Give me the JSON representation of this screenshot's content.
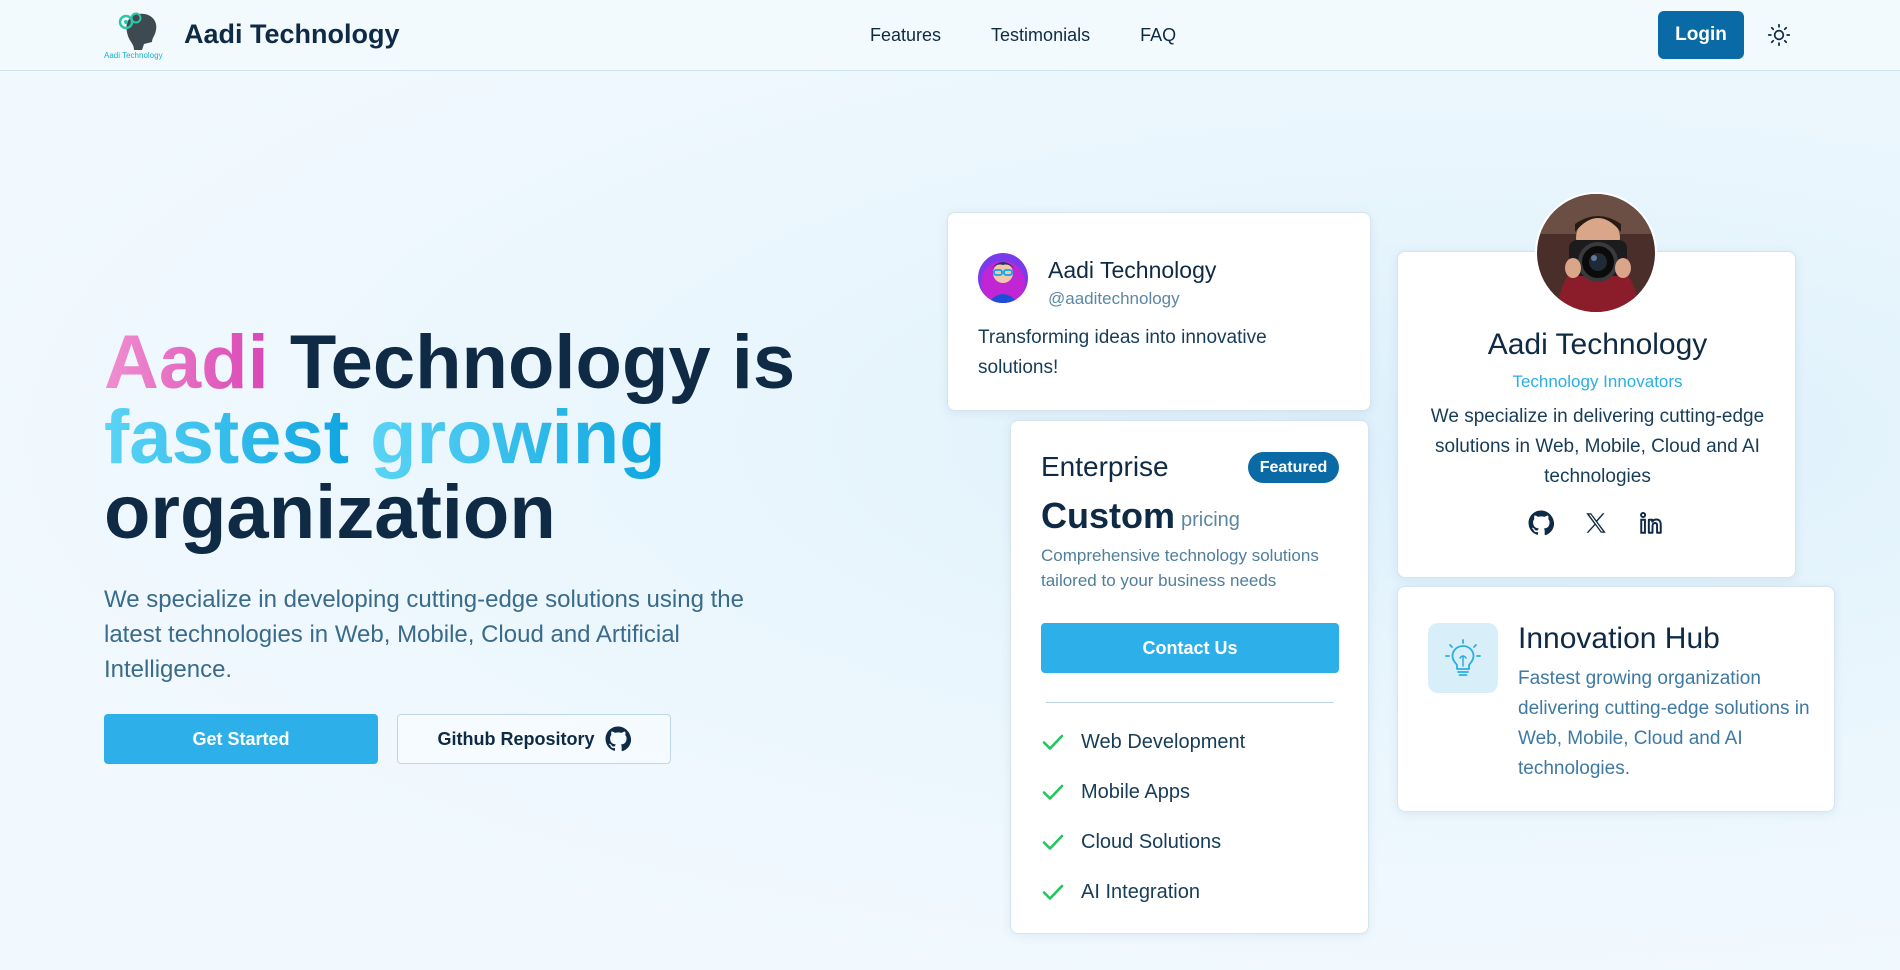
{
  "nav": {
    "brand_name": "Aadi Technology",
    "logo_text": "Aadi Technology",
    "links": [
      "Features",
      "Testimonials",
      "FAQ"
    ],
    "login_label": "Login"
  },
  "hero": {
    "title_part1": "Aadi",
    "title_part2": " Technology is",
    "title_part3": "fastest",
    "title_part4": "growing",
    "title_part5": "organization",
    "subtitle": "We specialize in developing cutting-edge solutions using the latest technologies in Web, Mobile, Cloud and Artificial Intelligence.",
    "primary_button": "Get Started",
    "secondary_button": "Github Repository"
  },
  "profile_card": {
    "name": "Aadi Technology",
    "handle": "@aaditechnology",
    "text": "Transforming ideas into innovative solutions!"
  },
  "pricing_card": {
    "plan": "Enterprise",
    "badge": "Featured",
    "price": "Custom",
    "price_unit": "pricing",
    "description": "Comprehensive technology solutions tailored to your business needs",
    "button": "Contact Us",
    "features": [
      "Web Development",
      "Mobile Apps",
      "Cloud Solutions",
      "AI Integration"
    ]
  },
  "team_card": {
    "name": "Aadi Technology",
    "role": "Technology Innovators",
    "description": "We specialize in delivering cutting-edge solutions in Web, Mobile, Cloud and AI technologies",
    "socials": [
      "github-icon",
      "x-icon",
      "linkedin-icon"
    ]
  },
  "hub_card": {
    "title": "Innovation Hub",
    "description": "Fastest growing organization delivering cutting-edge solutions in Web, Mobile, Cloud and AI technologies."
  },
  "colors": {
    "primary": "#2db0ea",
    "dark_blue": "#0a6aa5",
    "text_dark": "#0f2a44",
    "check_green": "#22c55e"
  }
}
